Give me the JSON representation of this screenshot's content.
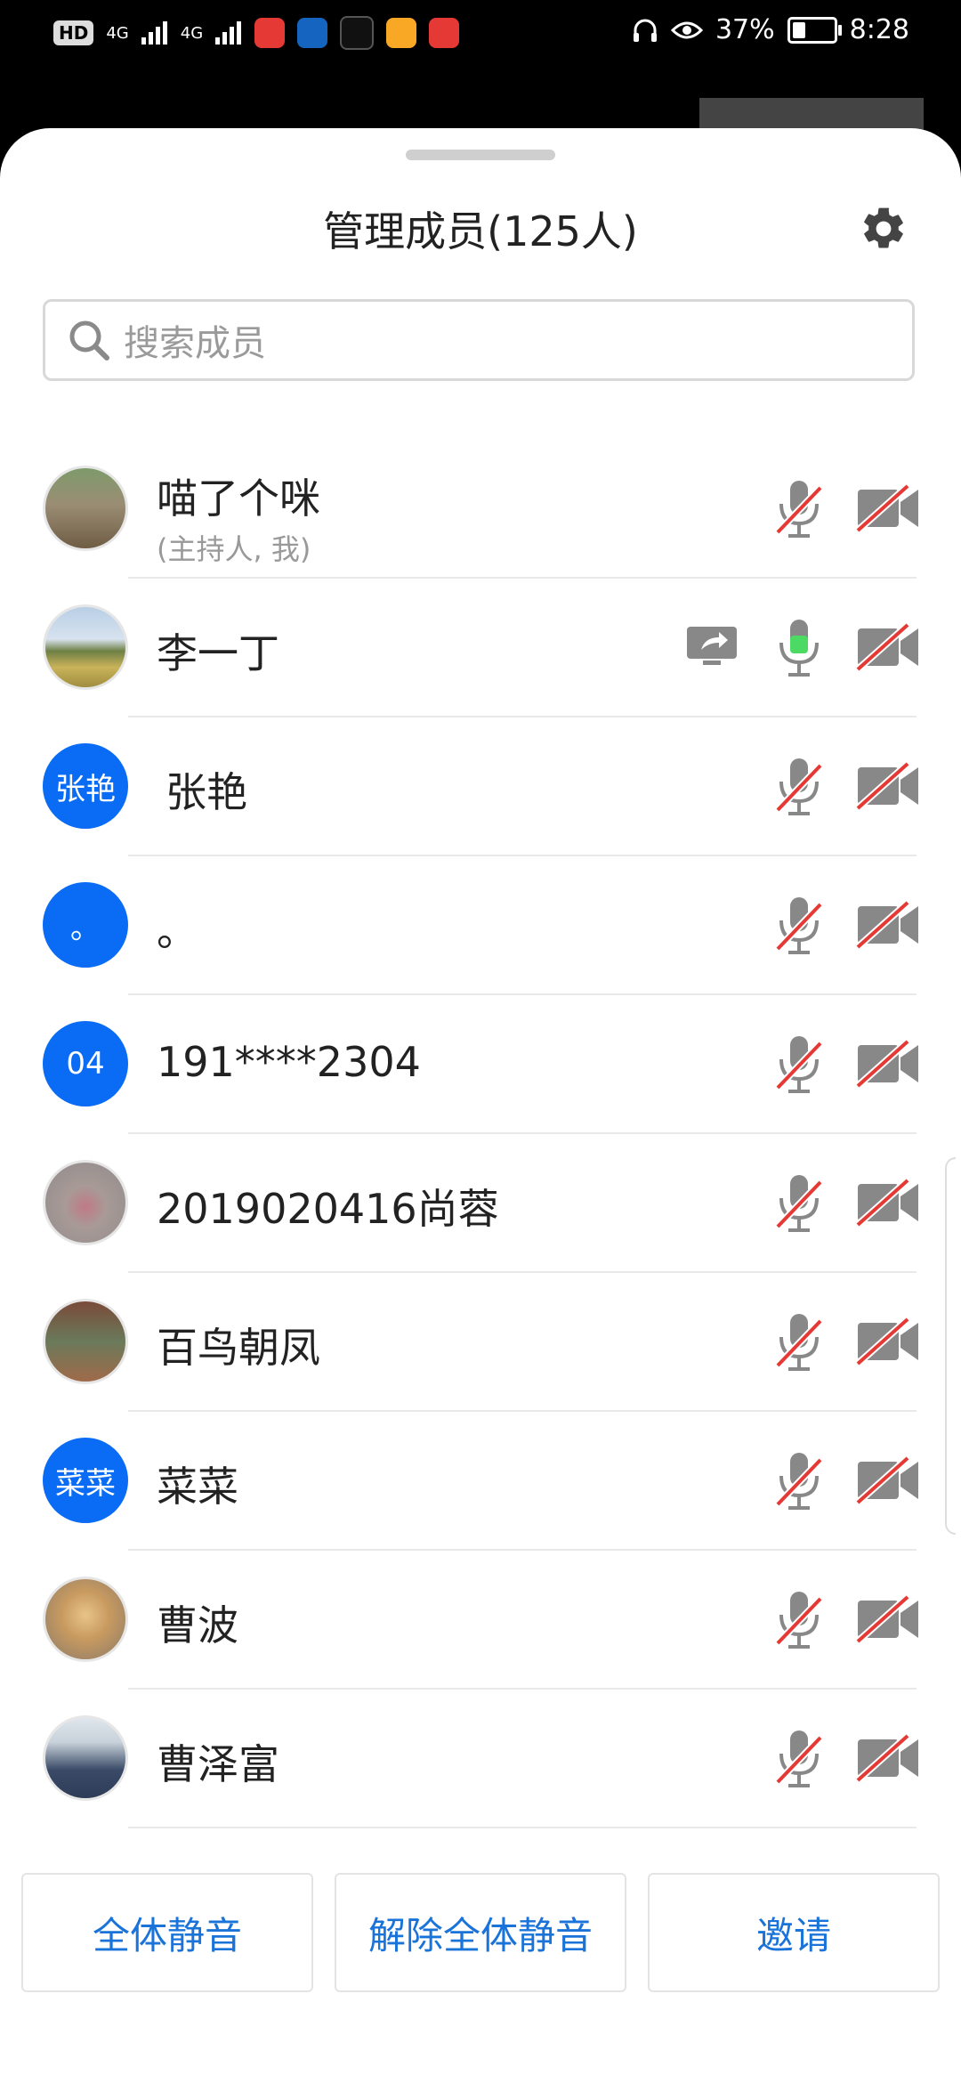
{
  "status_bar": {
    "left_badge": "HD",
    "net1": "4G",
    "net2": "4G",
    "battery": "37%",
    "time": "8:28",
    "app_icons": [
      "mic-app-icon",
      "maps-app-icon",
      "tiktok-app-icon",
      "gift-app-icon",
      "book-app-icon"
    ]
  },
  "header": {
    "title": "管理成员(125人)",
    "settings_icon": "gear-icon"
  },
  "search": {
    "placeholder": "搜索成员"
  },
  "members": [
    {
      "name": "喵了个咪",
      "sub": "(主持人, 我)",
      "avatar": "photo",
      "mic": "muted",
      "camera": "off"
    },
    {
      "name": "李一丁",
      "sub": "",
      "avatar": "photo",
      "mic": "active",
      "camera": "off",
      "sharing": true
    },
    {
      "name": "张艳",
      "sub": "",
      "avatar_text": "张艳",
      "mic": "muted",
      "camera": "off"
    },
    {
      "name": "。",
      "sub": "",
      "avatar_text": "。",
      "mic": "muted",
      "camera": "off"
    },
    {
      "name": "191****2304",
      "sub": "",
      "avatar_text": "04",
      "mic": "muted",
      "camera": "off"
    },
    {
      "name": "2019020416尚蓉",
      "sub": "",
      "avatar": "photo",
      "mic": "muted",
      "camera": "off"
    },
    {
      "name": "百鸟朝凤",
      "sub": "",
      "avatar": "photo",
      "mic": "muted",
      "camera": "off"
    },
    {
      "name": "菜菜",
      "sub": "",
      "avatar_text": "菜菜",
      "mic": "muted",
      "camera": "off"
    },
    {
      "name": "曹波",
      "sub": "",
      "avatar": "photo",
      "mic": "muted",
      "camera": "off"
    },
    {
      "name": "曹泽富",
      "sub": "",
      "avatar": "photo",
      "mic": "muted",
      "camera": "off"
    }
  ],
  "buttons": {
    "mute_all": "全体静音",
    "unmute_all": "解除全体静音",
    "invite": "邀请"
  },
  "colors": {
    "accent_blue": "#0a6cf5",
    "button_text": "#1a73d9",
    "mic_active_green": "#4cd964",
    "mute_slash_red": "#e53935"
  }
}
